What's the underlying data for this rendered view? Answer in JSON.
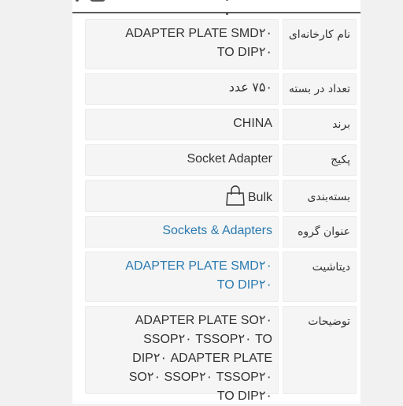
{
  "colors": {
    "link": "#2a7ab0",
    "text": "#333333",
    "cell_bg": "#f5f5f5",
    "logo_blue": "#1a6fc4"
  },
  "specs": [
    {
      "label": "نام کارخانه‌ای",
      "value": "ADAPTER PLATE SMD۲۰ TO DIP۲۰",
      "is_link": false
    },
    {
      "label": "تعداد در بسته",
      "value": "۷۵۰ عدد",
      "is_link": false
    },
    {
      "label": "برند",
      "value": "CHINA",
      "is_link": false
    },
    {
      "label": "پکیج",
      "value": "Socket Adapter",
      "is_link": false
    },
    {
      "label": "بسته‌بندی",
      "value": "Bulk",
      "icon": "shopping-bag-icon",
      "is_link": false
    },
    {
      "label": "عنوان گروه",
      "value": "Sockets & Adapters",
      "is_link": true
    },
    {
      "label": "دیتاشیت",
      "value": "ADAPTER PLATE SMD۲۰ TO DIP۲۰",
      "is_link": true
    },
    {
      "label": "توضیحات",
      "value": "ADAPTER PLATE SO۲۰ SSOP۲۰ TSSOP۲۰ TO DIP۲۰ ADAPTER PLATE SO۲۰ SSOP۲۰ TSSOP۲۰ TO DIP۲۰",
      "is_link": false
    }
  ]
}
